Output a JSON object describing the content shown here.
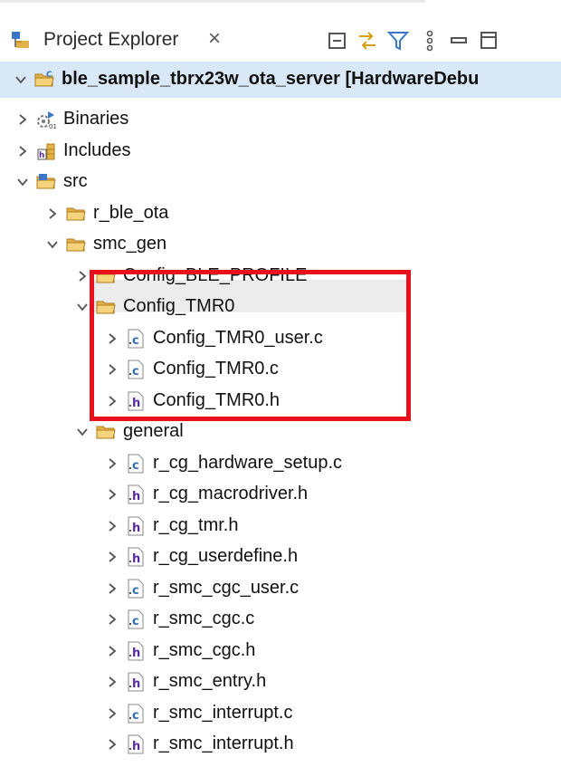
{
  "view": {
    "title": "Project Explorer",
    "close_symbol": "×"
  },
  "toolbar": {
    "buttons": [
      {
        "name": "collapse-all-icon"
      },
      {
        "name": "link-with-editor-icon"
      },
      {
        "name": "filter-icon"
      },
      {
        "name": "view-menu-icon"
      },
      {
        "name": "minimize-icon"
      },
      {
        "name": "maximize-icon"
      }
    ]
  },
  "tree": {
    "root": {
      "label": "ble_sample_tbrx23w_ota_server [HardwareDebu",
      "icon": "c-project-icon",
      "expanded": true
    },
    "nodes": [
      {
        "label": "Binaries",
        "icon": "binaries-icon",
        "expanded": false
      },
      {
        "label": "Includes",
        "icon": "includes-icon",
        "expanded": false
      },
      {
        "label": "src",
        "icon": "source-folder-icon",
        "expanded": true
      },
      {
        "label": "r_ble_ota",
        "icon": "folder-icon",
        "expanded": false
      },
      {
        "label": "smc_gen",
        "icon": "folder-icon",
        "expanded": true
      },
      {
        "label": "Config_BLE_PROFILE",
        "icon": "folder-icon",
        "expanded": false
      },
      {
        "label": "Config_TMR0",
        "icon": "folder-icon",
        "expanded": true
      },
      {
        "label": "Config_TMR0_user.c",
        "icon": "c-file-icon",
        "expanded": false
      },
      {
        "label": "Config_TMR0.c",
        "icon": "c-file-icon",
        "expanded": false
      },
      {
        "label": "Config_TMR0.h",
        "icon": "h-file-icon",
        "expanded": false
      },
      {
        "label": "general",
        "icon": "folder-icon",
        "expanded": true
      },
      {
        "label": "r_cg_hardware_setup.c",
        "icon": "c-file-icon",
        "expanded": false
      },
      {
        "label": "r_cg_macrodriver.h",
        "icon": "h-file-icon",
        "expanded": false
      },
      {
        "label": "r_cg_tmr.h",
        "icon": "h-file-icon",
        "expanded": false
      },
      {
        "label": "r_cg_userdefine.h",
        "icon": "h-file-icon",
        "expanded": false
      },
      {
        "label": "r_smc_cgc_user.c",
        "icon": "c-file-icon",
        "expanded": false
      },
      {
        "label": "r_smc_cgc.c",
        "icon": "c-file-icon",
        "expanded": false
      },
      {
        "label": "r_smc_cgc.h",
        "icon": "h-file-icon",
        "expanded": false
      },
      {
        "label": "r_smc_entry.h",
        "icon": "h-file-icon",
        "expanded": false
      },
      {
        "label": "r_smc_interrupt.c",
        "icon": "c-file-icon",
        "expanded": false
      },
      {
        "label": "r_smc_interrupt.h",
        "icon": "h-file-icon",
        "expanded": false
      }
    ]
  },
  "colors": {
    "root_row_bg": "#d9e8f7",
    "highlight_box": "#e8101a",
    "folder": "#e3b14a",
    "c_file": "#2f6db3",
    "h_file": "#5a2aa0"
  }
}
